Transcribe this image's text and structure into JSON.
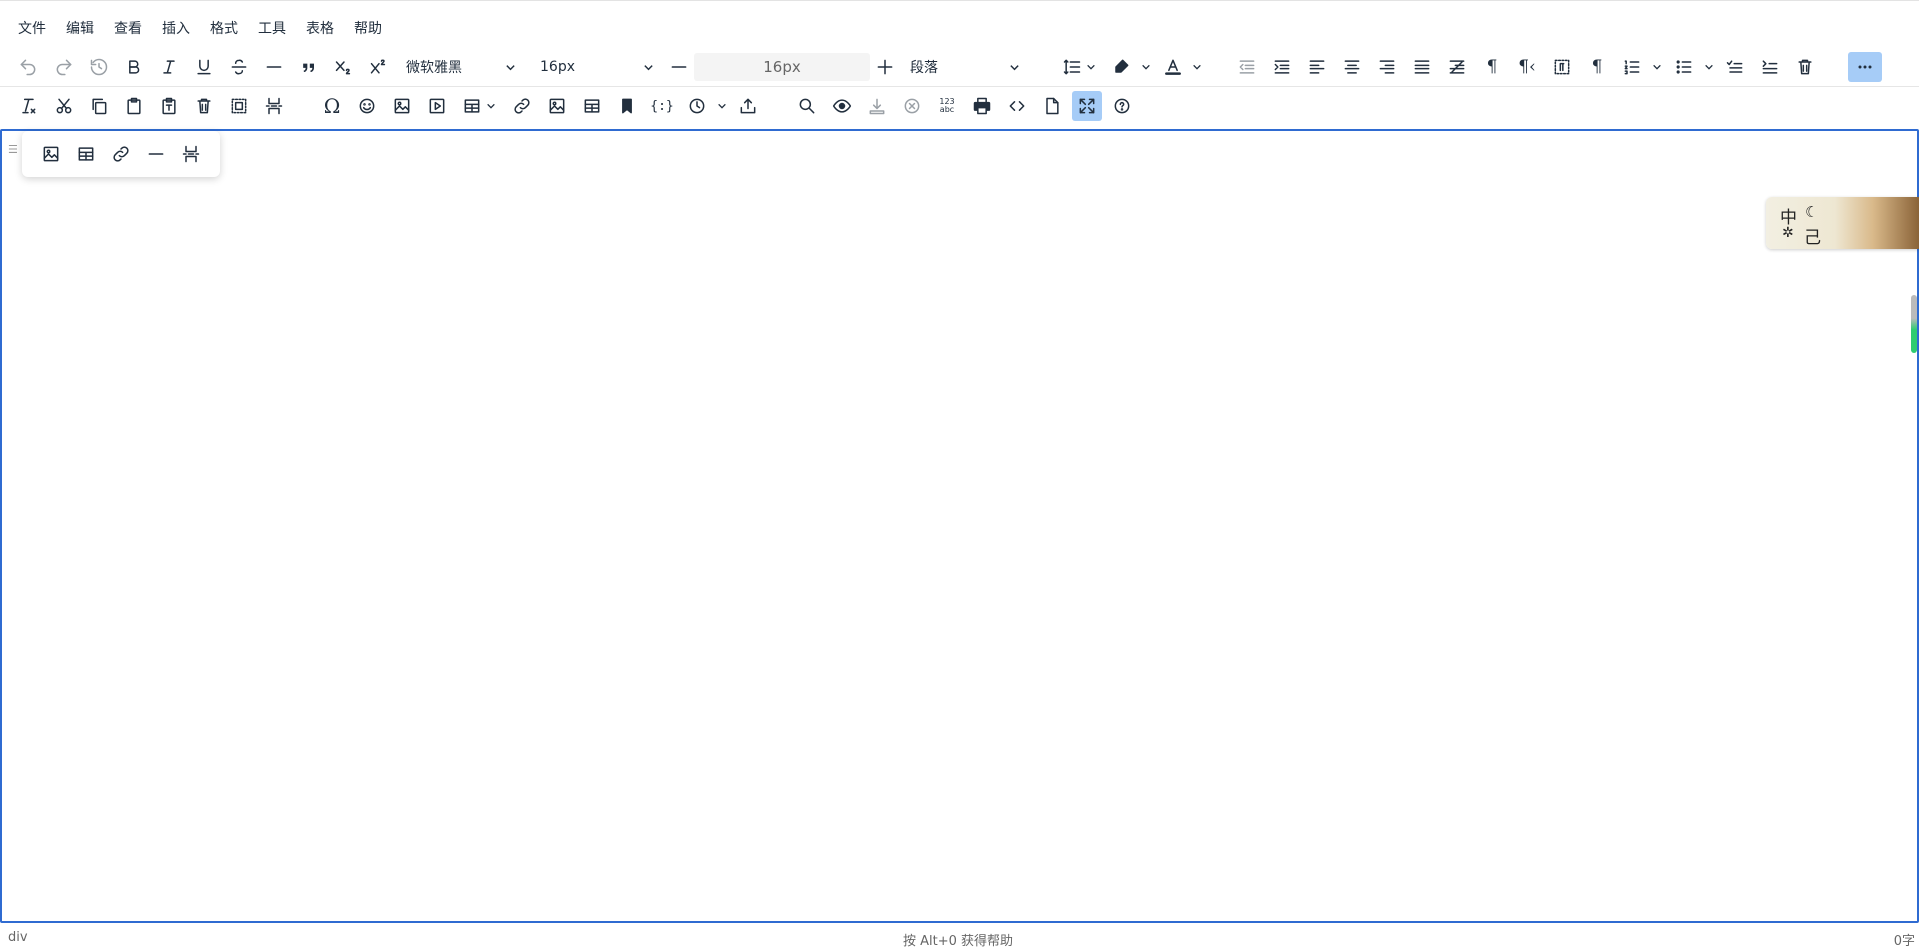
{
  "menubar": [
    "文件",
    "编辑",
    "查看",
    "插入",
    "格式",
    "工具",
    "表格",
    "帮助"
  ],
  "toolbar1": {
    "font_family": "微软雅黑",
    "font_size_select": "16px",
    "font_size_value": "16px",
    "block_format": "段落",
    "icons": [
      "undo-icon",
      "redo-icon",
      "restore-draft-icon",
      "bold-icon",
      "italic-icon",
      "underline-icon",
      "strikethrough-icon",
      "horizontal-line-icon",
      "blockquote-icon",
      "subscript-icon",
      "superscript-icon",
      "line-height-icon",
      "highlight-icon",
      "text-color-icon",
      "outdent-icon",
      "indent-icon",
      "align-left-icon",
      "align-center-icon",
      "align-right-icon",
      "justify-icon",
      "text-indent-icon",
      "ltr-icon",
      "rtl-icon",
      "visualblocks-icon",
      "visualchars-icon",
      "numbered-list-icon",
      "bullet-list-icon",
      "checklist-icon",
      "indent2em-icon",
      "delete-icon",
      "more-icon"
    ]
  },
  "toolbar2": {
    "icons": [
      "remove-format-icon",
      "cut-icon",
      "copy-icon",
      "paste-icon",
      "paste-text-icon",
      "clear-icon",
      "select-all-icon",
      "page-break-icon",
      "special-char-icon",
      "emoticons-icon",
      "image-icon",
      "media-icon",
      "table-icon",
      "link-icon",
      "image2-icon",
      "table2-icon",
      "anchor-icon",
      "template-icon",
      "datetime-icon",
      "upload-icon",
      "search-replace-icon",
      "preview-icon",
      "download-icon",
      "cancel-icon",
      "spellcheck-icon",
      "print-icon",
      "code-icon",
      "new-document-icon",
      "fullscreen-icon",
      "help-icon"
    ]
  },
  "quickbar": {
    "icons": [
      "image-icon",
      "table-icon",
      "link-icon",
      "horizontal-line-icon",
      "page-break-icon"
    ]
  },
  "ime": {
    "lang": "中",
    "mode": "己"
  },
  "statusbar": {
    "path": "div",
    "help": "按 Alt+0 获得帮助",
    "word_count": "0字"
  },
  "colors": {
    "focus_border": "#2f6bd1",
    "active_button": "#a6ccf7",
    "text": "#222f3e"
  }
}
